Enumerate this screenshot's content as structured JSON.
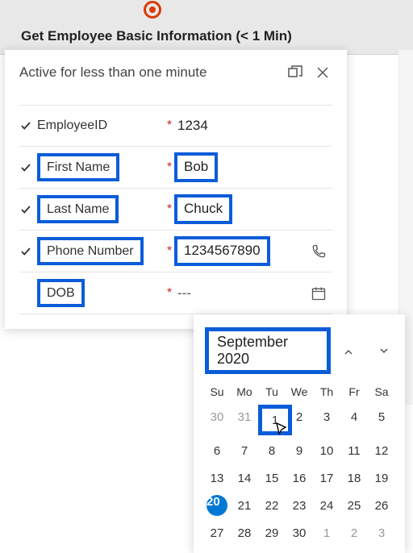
{
  "stage": {
    "title": "Get Employee Basic Information  (< 1 Min)"
  },
  "flyout": {
    "status": "Active for less than one minute",
    "fields": [
      {
        "label": "EmployeeID",
        "required": "*",
        "value": "1234",
        "hl_label": false,
        "hl_value": false,
        "trailing": ""
      },
      {
        "label": "First Name",
        "required": "*",
        "value": "Bob",
        "hl_label": true,
        "hl_value": true,
        "trailing": ""
      },
      {
        "label": "Last Name",
        "required": "*",
        "value": "Chuck",
        "hl_label": true,
        "hl_value": true,
        "trailing": ""
      },
      {
        "label": "Phone Number",
        "required": "*",
        "value": "1234567890",
        "hl_label": true,
        "hl_value": true,
        "trailing": "phone"
      },
      {
        "label": "DOB",
        "required": "*",
        "value": "---",
        "hl_label": true,
        "hl_value": false,
        "trailing": "calendar"
      }
    ]
  },
  "calendar": {
    "month_label": "September 2020",
    "weekdays": [
      "Su",
      "Mo",
      "Tu",
      "We",
      "Th",
      "Fr",
      "Sa"
    ],
    "days": [
      {
        "n": "30",
        "muted": true
      },
      {
        "n": "31",
        "muted": true
      },
      {
        "n": "1",
        "hl": true
      },
      {
        "n": "2"
      },
      {
        "n": "3"
      },
      {
        "n": "4"
      },
      {
        "n": "5"
      },
      {
        "n": "6"
      },
      {
        "n": "7"
      },
      {
        "n": "8"
      },
      {
        "n": "9"
      },
      {
        "n": "10"
      },
      {
        "n": "11"
      },
      {
        "n": "12"
      },
      {
        "n": "13"
      },
      {
        "n": "14"
      },
      {
        "n": "15"
      },
      {
        "n": "16"
      },
      {
        "n": "17"
      },
      {
        "n": "18"
      },
      {
        "n": "19"
      },
      {
        "n": "20",
        "today": true
      },
      {
        "n": "21"
      },
      {
        "n": "22"
      },
      {
        "n": "23"
      },
      {
        "n": "24"
      },
      {
        "n": "25"
      },
      {
        "n": "26"
      },
      {
        "n": "27"
      },
      {
        "n": "28"
      },
      {
        "n": "29"
      },
      {
        "n": "30"
      },
      {
        "n": "1",
        "muted": true
      },
      {
        "n": "2",
        "muted": true
      },
      {
        "n": "3",
        "muted": true
      }
    ]
  }
}
